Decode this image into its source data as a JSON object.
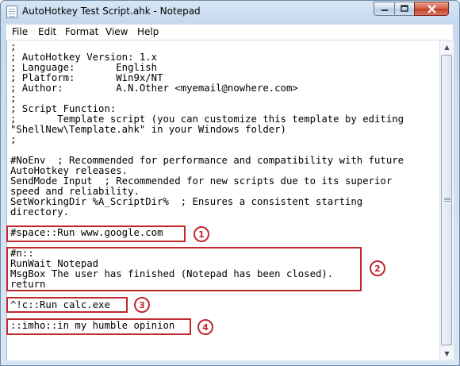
{
  "window": {
    "title": "AutoHotkey Test Script.ahk - Notepad"
  },
  "title_controls": {
    "minimize_icon": "minimize-icon",
    "maximize_icon": "maximize-icon",
    "close_icon": "close-icon"
  },
  "menu": [
    "File",
    "Edit",
    "Format",
    "View",
    "Help"
  ],
  "editor": {
    "text": ";\n; AutoHotkey Version: 1.x\n; Language:       English\n; Platform:       Win9x/NT\n; Author:         A.N.Other <myemail@nowhere.com>\n;\n; Script Function:\n;       Template script (you can customize this template by editing\n\"ShellNew\\Template.ahk\" in your Windows folder)\n;\n\n#NoEnv  ; Recommended for performance and compatibility with future\nAutoHotkey releases.\nSendMode Input  ; Recommended for new scripts due to its superior\nspeed and reliability.\nSetWorkingDir %A_ScriptDir%  ; Ensures a consistent starting\ndirectory.\n\n#space::Run www.google.com\n\n#n::\nRunWait Notepad\nMsgBox The user has finished (Notepad has been closed).\nreturn\n\n^!c::Run calc.exe\n\n::imho::in my humble opinion"
  },
  "annotations": [
    "1",
    "2",
    "3",
    "4"
  ],
  "colors": {
    "annotation": "#c0282d",
    "frame": "#c4d8ee"
  }
}
